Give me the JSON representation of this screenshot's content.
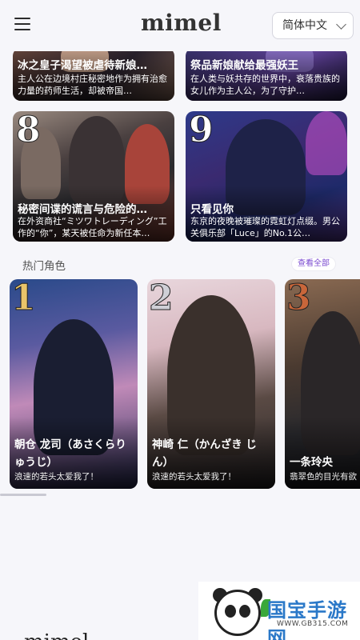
{
  "header": {
    "logo": "mimel",
    "language": "简体中文"
  },
  "stories": [
    {
      "title": "冰之皇子渴望被虐待新娘…",
      "desc": "主人公在边境村庄秘密地作为拥有治愈力量的药师生活，却被帝国…"
    },
    {
      "title": "祭品新娘献给最强妖王",
      "desc": "在人类与妖共存的世界中，衰落贵族的女儿作为主人公，为了守护…"
    },
    {
      "rank": "8",
      "title": "秘密间谍的谎言与危险的…",
      "desc": "在外资商社“ミツワトレーディング”工作的“你”，某天被任命为新任本…"
    },
    {
      "rank": "9",
      "title": "只看见你",
      "desc": "东京的夜晚被璀璨的霓虹灯点缀。男公关俱乐部「Luce」的No.1公…"
    }
  ],
  "section": {
    "title": "热门角色",
    "view_all": "查看全部"
  },
  "characters": [
    {
      "rank": "1",
      "name": "朝仓 龙司（あさくらりゅうじ）",
      "tag": "浪速的若头太爱我了！"
    },
    {
      "rank": "2",
      "name": "神崎 仁（かんざき じん）",
      "tag": "浪速的若头太爱我了！"
    },
    {
      "rank": "3",
      "name": "一条玲央",
      "tag": "翡翠色的目光有欲一…"
    }
  ],
  "watermark": {
    "brand": "国宝手游网",
    "url": "WWW.GB315.COM"
  },
  "colors": {
    "background": "#f6f6fa",
    "accent": "#7a4ad0",
    "rank_gold": "#e9c46a",
    "rank_silver": "#cfcfd6",
    "rank_bronze": "#c8663a"
  }
}
